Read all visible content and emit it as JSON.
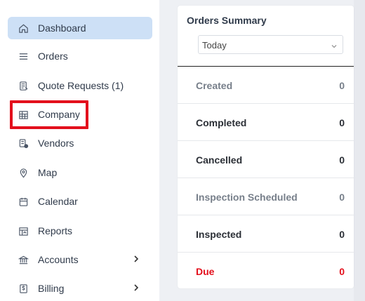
{
  "sidebar": {
    "items": [
      {
        "label": "Dashboard",
        "icon": "home-icon",
        "active": true
      },
      {
        "label": "Orders",
        "icon": "list-icon"
      },
      {
        "label": "Quote Requests (1)",
        "icon": "quote-icon"
      },
      {
        "label": "Company",
        "icon": "building-icon"
      },
      {
        "label": "Vendors",
        "icon": "vendor-icon"
      },
      {
        "label": "Map",
        "icon": "map-pin-icon"
      },
      {
        "label": "Calendar",
        "icon": "calendar-icon"
      },
      {
        "label": "Reports",
        "icon": "reports-icon"
      },
      {
        "label": "Accounts",
        "icon": "bank-icon",
        "has_submenu": true
      },
      {
        "label": "Billing",
        "icon": "billing-icon",
        "has_submenu": true
      }
    ]
  },
  "summary": {
    "title": "Orders Summary",
    "period": "Today",
    "rows": [
      {
        "label": "Created",
        "value": "0"
      },
      {
        "label": "Completed",
        "value": "0"
      },
      {
        "label": "Cancelled",
        "value": "0"
      },
      {
        "label": "Inspection Scheduled",
        "value": "0"
      },
      {
        "label": "Inspected",
        "value": "0"
      },
      {
        "label": "Due",
        "value": "0"
      }
    ]
  },
  "colors": {
    "active_bg": "#cde0f6",
    "highlight": "#e3101c",
    "due": "#e3101c"
  }
}
